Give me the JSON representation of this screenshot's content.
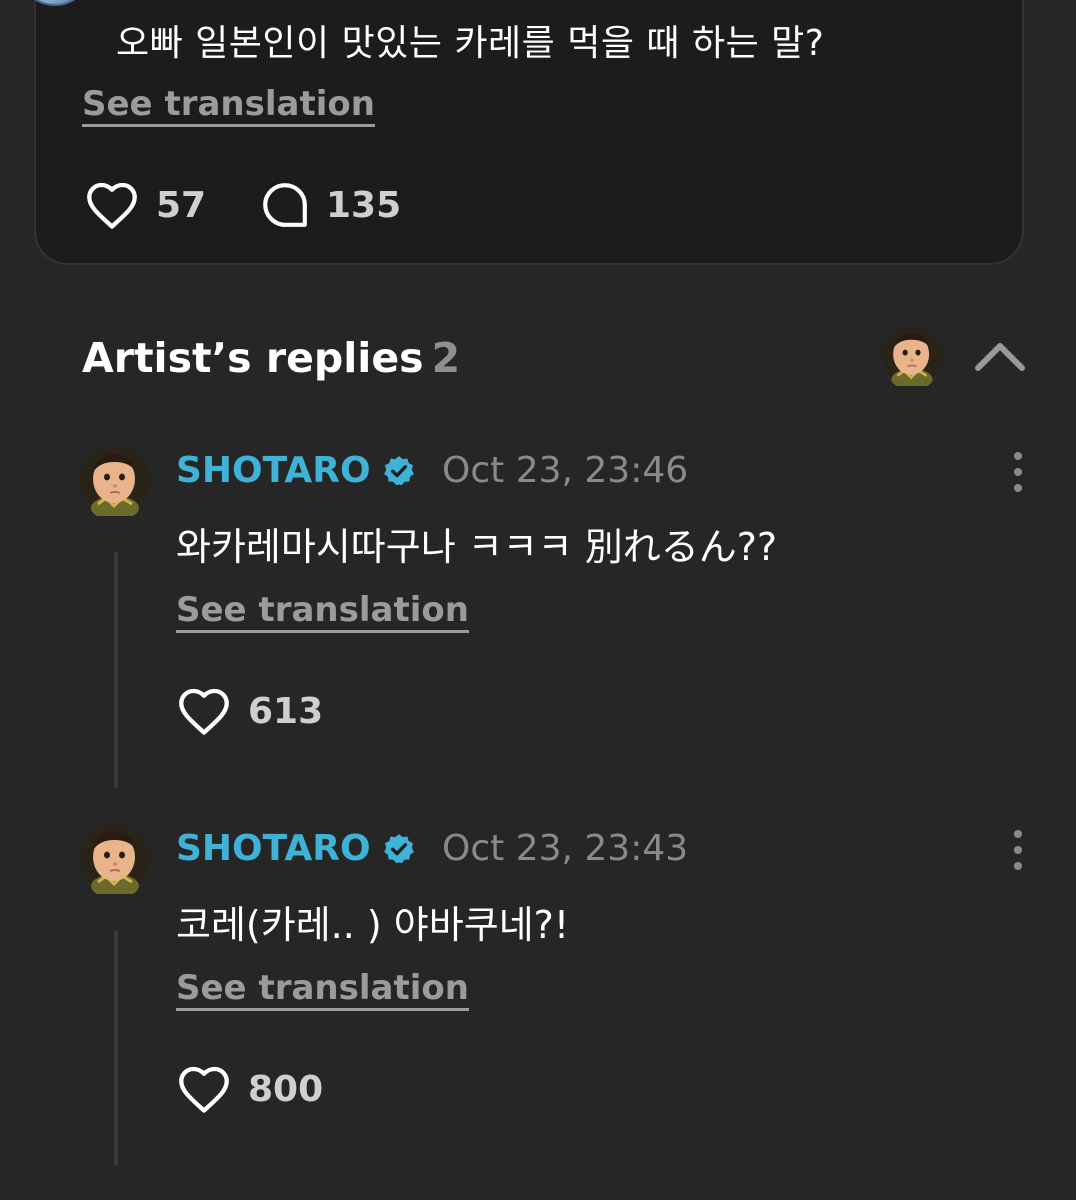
{
  "post": {
    "text": "오빠 일본인이 맛있는 카레를 먹을 때 하는 말?",
    "see_translation": "See translation",
    "likes": "57",
    "comments": "135"
  },
  "replies_section": {
    "title": "Artist’s replies",
    "count": "2"
  },
  "replies": [
    {
      "username": "SHOTARO",
      "timestamp": "Oct 23, 23:46",
      "text": "와카레마시따구나 ㅋㅋㅋ  別れるん??",
      "see_translation": "See translation",
      "likes": "613"
    },
    {
      "username": "SHOTARO",
      "timestamp": "Oct 23, 23:43",
      "text": "코레(카레.. ) 야바쿠네?!",
      "see_translation": "See translation",
      "likes": "800"
    }
  ],
  "colors": {
    "background": "#262626",
    "card": "#1c1c1c",
    "username": "#3fb2d8",
    "muted": "#8a8a8a"
  },
  "icons": [
    "heart-icon",
    "comment-icon",
    "verified-icon",
    "chevron-up-icon",
    "more-vertical-icon"
  ]
}
